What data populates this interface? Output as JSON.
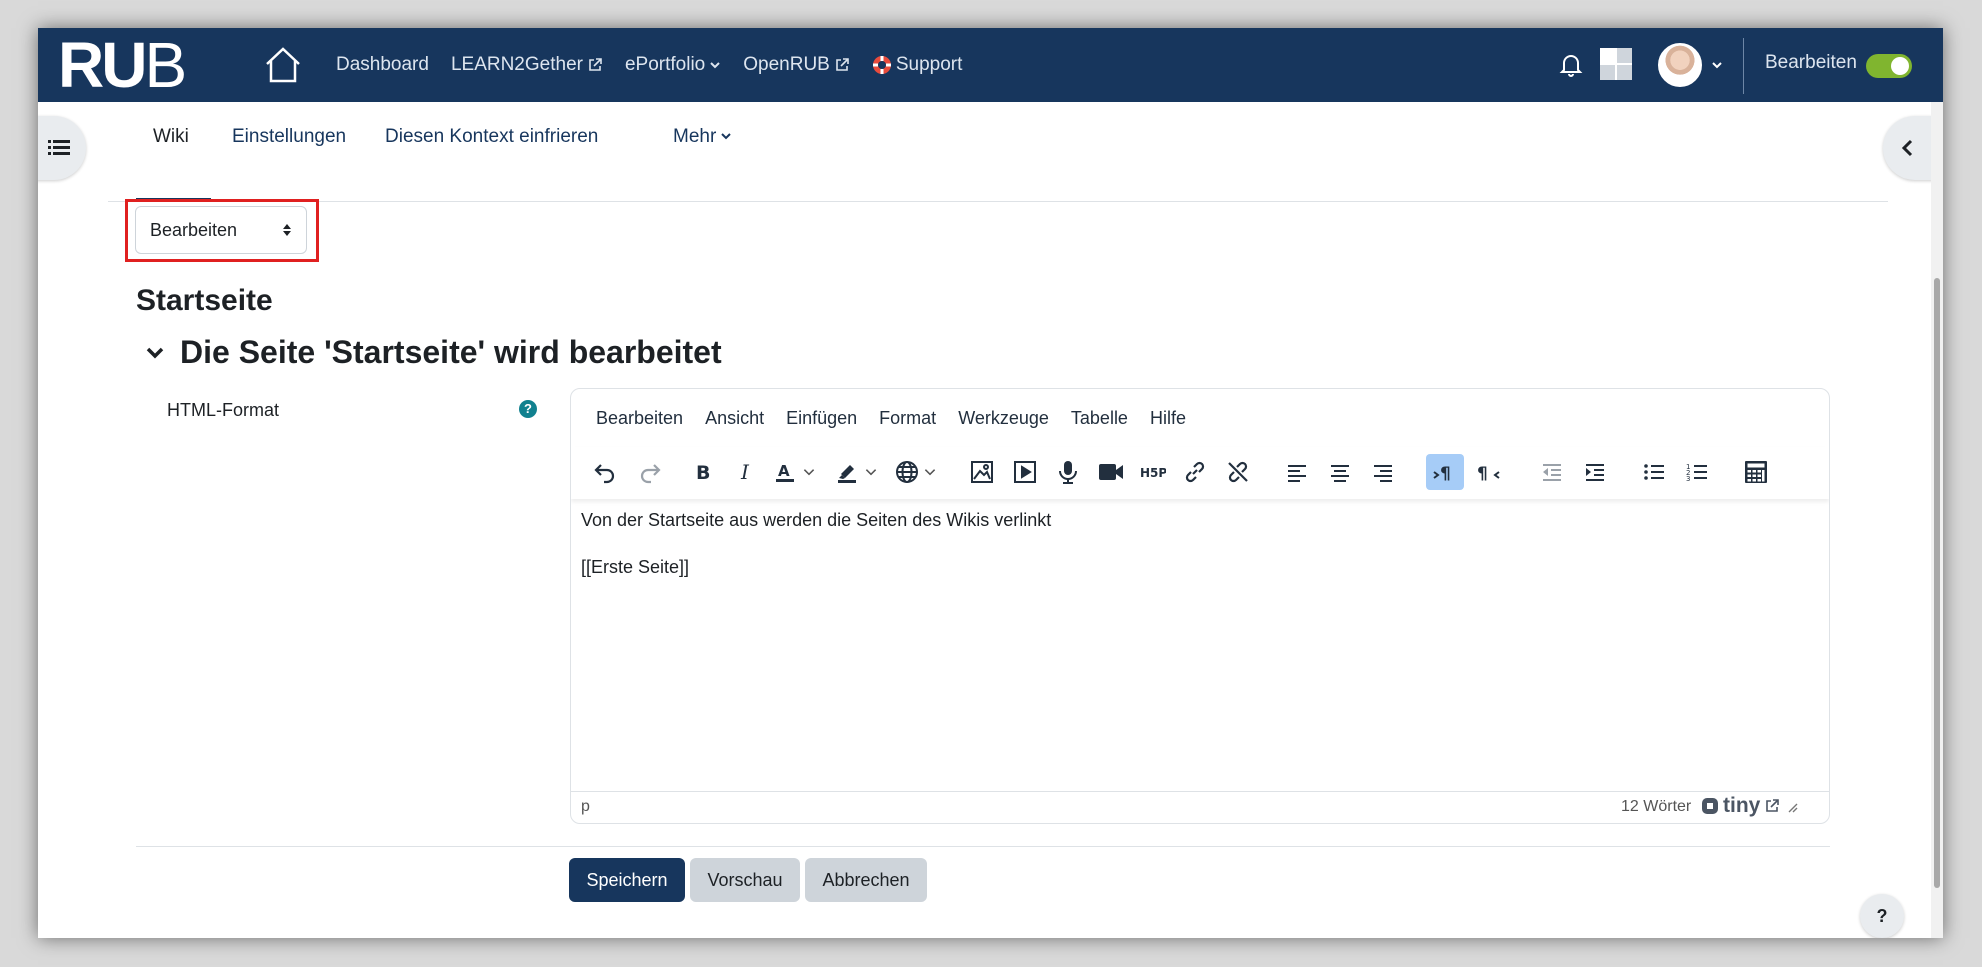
{
  "brand": {
    "logo": "RUB"
  },
  "navbar": {
    "links": [
      {
        "label": "Dashboard",
        "external": false
      },
      {
        "label": "LEARN2Gether",
        "external": true
      },
      {
        "label": "ePortfolio",
        "dropdown": true
      },
      {
        "label": "OpenRUB",
        "external": true
      },
      {
        "label": "Support",
        "icon": "lifebuoy-icon"
      }
    ],
    "edit_mode_label": "Bearbeiten",
    "edit_mode_on": true
  },
  "secondary_nav": {
    "tabs": [
      "Wiki",
      "Einstellungen",
      "Diesen Kontext einfrieren",
      "Mehr"
    ],
    "active_tab": "Wiki"
  },
  "mode_select": {
    "value": "Bearbeiten"
  },
  "page": {
    "title": "Startseite",
    "section_heading": "Die Seite 'Startseite' wird bearbeitet"
  },
  "form": {
    "field_label": "HTML-Format",
    "help_icon": "?"
  },
  "editor": {
    "menu": [
      "Bearbeiten",
      "Ansicht",
      "Einfügen",
      "Format",
      "Werkzeuge",
      "Tabelle",
      "Hilfe"
    ],
    "content": [
      "Von der Startseite aus werden die Seiten des Wikis verlinkt",
      "[[Erste Seite]]"
    ],
    "status_path": "p",
    "word_count": "12 Wörter",
    "brand": "tiny"
  },
  "buttons": {
    "save": "Speichern",
    "preview": "Vorschau",
    "cancel": "Abbrechen"
  },
  "help_float": "?",
  "colors": {
    "navbar": "#17365d",
    "toggle_on": "#80b52f",
    "highlight": "#e02020",
    "primary": "#17365d"
  }
}
